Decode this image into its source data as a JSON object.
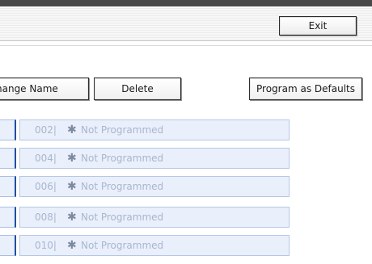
{
  "header": {
    "exit_label": "Exit"
  },
  "actions": {
    "change_name_label": "hange Name",
    "delete_label": "Delete",
    "program_defaults_label": "Program as Defaults"
  },
  "list": {
    "rows": [
      {
        "number": "002|",
        "mark": "✱",
        "text": "Not Programmed"
      },
      {
        "number": "004|",
        "mark": "✱",
        "text": "Not Programmed"
      },
      {
        "number": "006|",
        "mark": "✱",
        "text": "Not Programmed"
      },
      {
        "number": "008|",
        "mark": "✱",
        "text": "Not Programmed"
      },
      {
        "number": "010|",
        "mark": "✱",
        "text": "Not Programmed"
      }
    ]
  }
}
